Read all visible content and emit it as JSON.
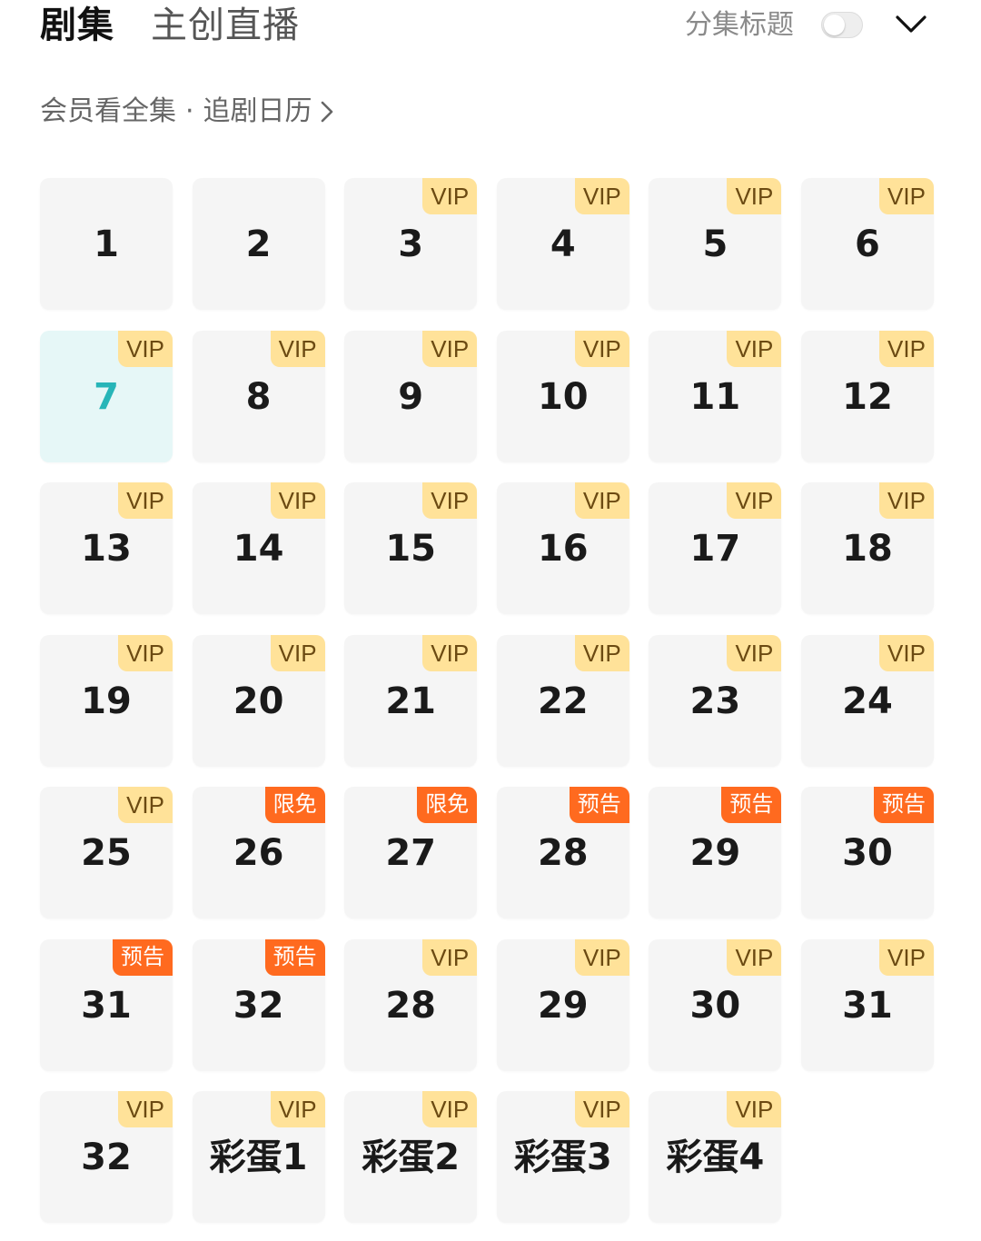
{
  "header": {
    "tabs": [
      {
        "label": "剧集",
        "active": true
      },
      {
        "label": "主创直播",
        "active": false
      }
    ],
    "toggle_label": "分集标题",
    "toggle_on": false
  },
  "subline": {
    "text": "会员看全集",
    "dot": "·",
    "link": "追剧日历"
  },
  "colors": {
    "vip_badge_bg": "#ffe299",
    "vip_badge_text": "#6b4a12",
    "promo_badge_bg": "#ff6a1f",
    "current_cell_bg": "#e6f7f7",
    "current_cell_text": "#27b5b8",
    "cell_bg": "#f5f5f5"
  },
  "episodes": [
    {
      "label": "1",
      "badge": null,
      "current": false
    },
    {
      "label": "2",
      "badge": null,
      "current": false
    },
    {
      "label": "3",
      "badge": "VIP",
      "badge_type": "vip",
      "current": false
    },
    {
      "label": "4",
      "badge": "VIP",
      "badge_type": "vip",
      "current": false
    },
    {
      "label": "5",
      "badge": "VIP",
      "badge_type": "vip",
      "current": false
    },
    {
      "label": "6",
      "badge": "VIP",
      "badge_type": "vip",
      "current": false
    },
    {
      "label": "7",
      "badge": "VIP",
      "badge_type": "vip",
      "current": true
    },
    {
      "label": "8",
      "badge": "VIP",
      "badge_type": "vip",
      "current": false
    },
    {
      "label": "9",
      "badge": "VIP",
      "badge_type": "vip",
      "current": false
    },
    {
      "label": "10",
      "badge": "VIP",
      "badge_type": "vip",
      "current": false
    },
    {
      "label": "11",
      "badge": "VIP",
      "badge_type": "vip",
      "current": false
    },
    {
      "label": "12",
      "badge": "VIP",
      "badge_type": "vip",
      "current": false
    },
    {
      "label": "13",
      "badge": "VIP",
      "badge_type": "vip",
      "current": false
    },
    {
      "label": "14",
      "badge": "VIP",
      "badge_type": "vip",
      "current": false
    },
    {
      "label": "15",
      "badge": "VIP",
      "badge_type": "vip",
      "current": false
    },
    {
      "label": "16",
      "badge": "VIP",
      "badge_type": "vip",
      "current": false
    },
    {
      "label": "17",
      "badge": "VIP",
      "badge_type": "vip",
      "current": false
    },
    {
      "label": "18",
      "badge": "VIP",
      "badge_type": "vip",
      "current": false
    },
    {
      "label": "19",
      "badge": "VIP",
      "badge_type": "vip",
      "current": false
    },
    {
      "label": "20",
      "badge": "VIP",
      "badge_type": "vip",
      "current": false
    },
    {
      "label": "21",
      "badge": "VIP",
      "badge_type": "vip",
      "current": false
    },
    {
      "label": "22",
      "badge": "VIP",
      "badge_type": "vip",
      "current": false
    },
    {
      "label": "23",
      "badge": "VIP",
      "badge_type": "vip",
      "current": false
    },
    {
      "label": "24",
      "badge": "VIP",
      "badge_type": "vip",
      "current": false
    },
    {
      "label": "25",
      "badge": "VIP",
      "badge_type": "vip",
      "current": false
    },
    {
      "label": "26",
      "badge": "限免",
      "badge_type": "free",
      "current": false
    },
    {
      "label": "27",
      "badge": "限免",
      "badge_type": "free",
      "current": false
    },
    {
      "label": "28",
      "badge": "预告",
      "badge_type": "preview",
      "current": false
    },
    {
      "label": "29",
      "badge": "预告",
      "badge_type": "preview",
      "current": false
    },
    {
      "label": "30",
      "badge": "预告",
      "badge_type": "preview",
      "current": false
    },
    {
      "label": "31",
      "badge": "预告",
      "badge_type": "preview",
      "current": false
    },
    {
      "label": "32",
      "badge": "预告",
      "badge_type": "preview",
      "current": false
    },
    {
      "label": "28",
      "badge": "VIP",
      "badge_type": "vip",
      "current": false
    },
    {
      "label": "29",
      "badge": "VIP",
      "badge_type": "vip",
      "current": false
    },
    {
      "label": "30",
      "badge": "VIP",
      "badge_type": "vip",
      "current": false
    },
    {
      "label": "31",
      "badge": "VIP",
      "badge_type": "vip",
      "current": false
    },
    {
      "label": "32",
      "badge": "VIP",
      "badge_type": "vip",
      "current": false
    },
    {
      "label": "彩蛋1",
      "badge": "VIP",
      "badge_type": "vip",
      "current": false
    },
    {
      "label": "彩蛋2",
      "badge": "VIP",
      "badge_type": "vip",
      "current": false
    },
    {
      "label": "彩蛋3",
      "badge": "VIP",
      "badge_type": "vip",
      "current": false
    },
    {
      "label": "彩蛋4",
      "badge": "VIP",
      "badge_type": "vip",
      "current": false
    }
  ]
}
